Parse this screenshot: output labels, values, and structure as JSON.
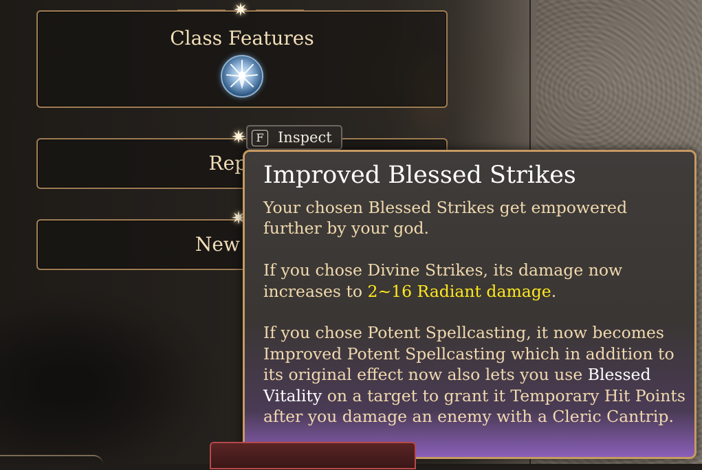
{
  "menu": {
    "class_features_label": "Class Features",
    "replace_label": "Replac",
    "new_feat_label": "New Feat"
  },
  "inspect_hint": {
    "key": "F",
    "label": "Inspect"
  },
  "tooltip": {
    "title": "Improved Blessed Strikes",
    "para1": "Your chosen Blessed Strikes get empowered further by your god.",
    "para2_prefix": "If you chose Divine Strikes, its damage now increases to ",
    "para2_highlight": "2~16 Radiant damage",
    "para2_suffix": ".",
    "para3_prefix": "If you chose Potent Spellcasting, it now becomes Improved Potent Spellcasting which in addition to its original effect now also lets you use ",
    "para3_highlight": "Blessed Vitality",
    "para3_suffix": " on a target to grant it Temporary Hit Points after you damage an enemy with a Cleric Cantrip."
  },
  "colors": {
    "frame_gold": "#a07e55",
    "tooltip_border": "#c69a62",
    "body_text": "#f0d9ae",
    "highlight_yellow": "#ffe81f",
    "bottom_button_red": "#b8484a"
  },
  "icons": {
    "class_icon": "divine-strike-emblem-icon",
    "star": "sparkle-star-icon"
  }
}
